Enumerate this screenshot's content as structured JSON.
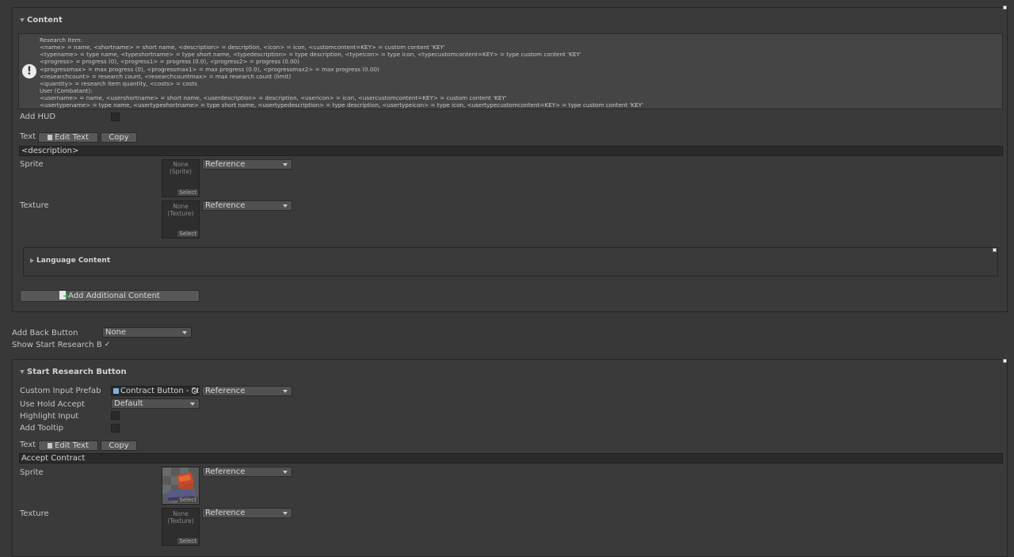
{
  "content_section": {
    "title": "Content",
    "info_lines": [
      "Research Item:",
      "<name> = name, <shortname> = short name, <description> = description, <icon> = icon, <customcontent=KEY> = custom content 'KEY'",
      "<typename> = type name, <typeshortname> = type short name, <typedescription> = type description, <typeicon> = type icon, <typecustomcontent=KEY> = type custom content 'KEY'",
      "<progress> = progress (0), <progress1> = progress (0.0), <progress2> = progress (0.00)",
      "<progressmax> = max progress (0), <progressmax1> = max progress (0.0), <progressmax2> = max progress (0.00)",
      "<researchcount> = research count, <researchcountmax> = max research count (limit)",
      "<quantity> = research item quantity, <costs> = costs",
      "User (Combatant):",
      "<username> = name, <usershortname> = short name, <userdescription> = description, <usericon> = icon, <usercustomcontent=KEY> = custom content 'KEY'",
      "<usertypename> = type name, <usertypeshortname> = type short name, <usertypedescription> = type description, <usertypeicon> = type icon, <usertypecustomcontent=KEY> = type custom content 'KEY'"
    ],
    "add_hud_label": "Add HUD",
    "text_label": "Text",
    "edit_text_label": "Edit Text",
    "copy_label": "Copy",
    "text_value": "<description>",
    "sprite_label": "Sprite",
    "sprite_none": "None (Sprite)",
    "texture_label": "Texture",
    "texture_none": "None\n(Texture)",
    "select_label": "Select",
    "reference_label": "Reference",
    "language_content_title": "Language Content",
    "add_additional_content_label": "Add Additional Content"
  },
  "add_back_button": {
    "label": "Add Back Button",
    "value": "None"
  },
  "show_start_research": {
    "label": "Show Start Research Button",
    "checked": true
  },
  "start_research_section": {
    "title": "Start Research Button",
    "custom_input_prefab_label": "Custom Input Prefab",
    "custom_input_prefab_value": "Contract Button - St",
    "reference_label": "Reference",
    "use_hold_accept_label": "Use Hold Accept",
    "use_hold_accept_value": "Default",
    "highlight_input_label": "Highlight Input",
    "add_tooltip_label": "Add Tooltip",
    "text_label": "Text",
    "edit_text_label": "Edit Text",
    "copy_label": "Copy",
    "text_value": "Accept Contract",
    "sprite_label": "Sprite",
    "texture_label": "Texture",
    "texture_none": "None\n(Texture)",
    "select_label": "Select"
  }
}
